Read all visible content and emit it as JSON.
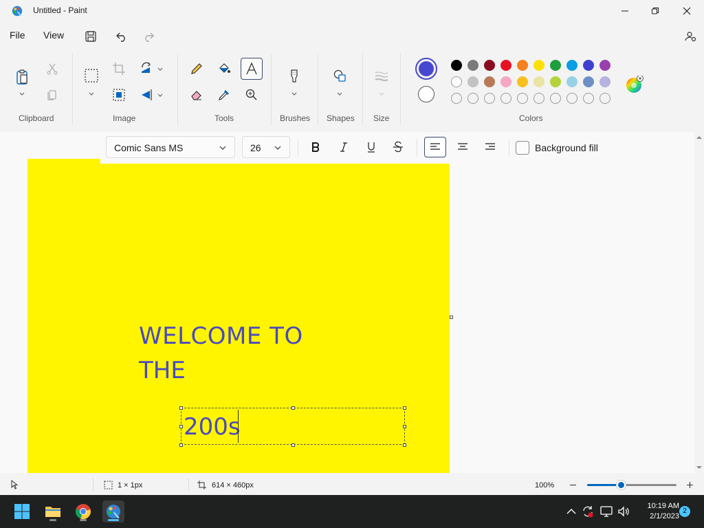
{
  "window": {
    "title": "Untitled - Paint"
  },
  "menu": {
    "file": "File",
    "view": "View"
  },
  "ribbon": {
    "groups": {
      "clipboard": "Clipboard",
      "image": "Image",
      "tools": "Tools",
      "brushes": "Brushes",
      "shapes": "Shapes",
      "size": "Size",
      "colors": "Colors"
    },
    "active_tool": "text-tool",
    "primary_color": "#4747cf",
    "secondary_color": "#ffffff",
    "palette_row1": [
      "#000000",
      "#7a7a7a",
      "#8a0c1f",
      "#e81123",
      "#f7811f",
      "#fce100",
      "#1e9e3c",
      "#0a9ee4",
      "#3f3fd0",
      "#9a3fae"
    ],
    "palette_row2": [
      "#ffffff",
      "#c3c3c3",
      "#b87a56",
      "#f4a8c4",
      "#f9c11d",
      "#e9e4a4",
      "#b4d33b",
      "#98d2e6",
      "#6e8fc6",
      "#b5b2e0"
    ]
  },
  "text_format": {
    "font": "Comic Sans MS",
    "size": "26",
    "background_fill_label": "Background fill",
    "background_fill_checked": false,
    "alignment": "left"
  },
  "canvas": {
    "background": "#fff500",
    "text_color": "#4a4abf",
    "line1": "WELCOME TO",
    "line2": "THE",
    "editing_text": "200s"
  },
  "status": {
    "selection_size": "1 × 1px",
    "canvas_size": "614 × 460px",
    "zoom": "100%",
    "zoom_fraction": 0.38
  },
  "taskbar": {
    "time": "10:19 AM",
    "date": "2/1/2023",
    "notification_count": "2"
  }
}
